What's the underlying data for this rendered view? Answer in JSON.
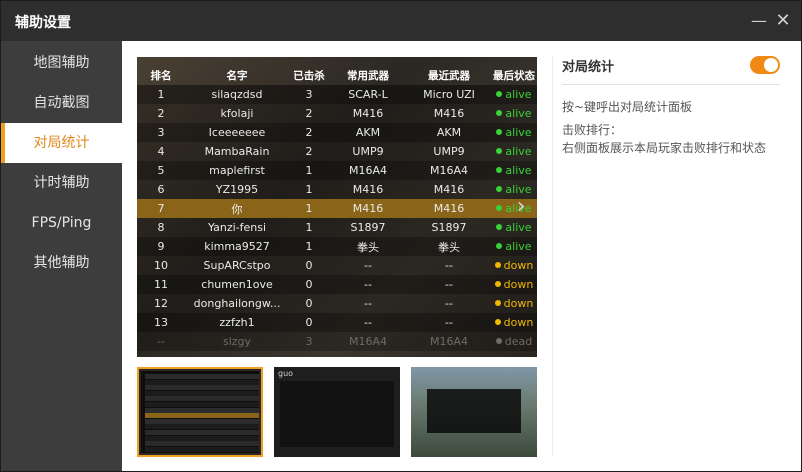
{
  "window": {
    "title": "辅助设置",
    "min_glyph": "—",
    "close_glyph": "✕"
  },
  "sidebar": {
    "items": [
      {
        "label": "地图辅助",
        "active": false
      },
      {
        "label": "自动截图",
        "active": false
      },
      {
        "label": "对局统计",
        "active": true
      },
      {
        "label": "计时辅助",
        "active": false
      },
      {
        "label": "FPS/Ping",
        "active": false
      },
      {
        "label": "其他辅助",
        "active": false
      }
    ]
  },
  "preview": {
    "headers": [
      "排名",
      "名字",
      "已击杀",
      "常用武器",
      "最近武器",
      "最后状态"
    ],
    "rows": [
      {
        "rank": "1",
        "name": "silaqzdsd",
        "kills": "3",
        "weapon_common": "SCAR-L",
        "weapon_recent": "Micro UZI",
        "status": "alive"
      },
      {
        "rank": "2",
        "name": "kfolaji",
        "kills": "2",
        "weapon_common": "M416",
        "weapon_recent": "M416",
        "status": "alive"
      },
      {
        "rank": "3",
        "name": "Iceeeeeee",
        "kills": "2",
        "weapon_common": "AKM",
        "weapon_recent": "AKM",
        "status": "alive"
      },
      {
        "rank": "4",
        "name": "MambaRain",
        "kills": "2",
        "weapon_common": "UMP9",
        "weapon_recent": "UMP9",
        "status": "alive"
      },
      {
        "rank": "5",
        "name": "maplefirst",
        "kills": "1",
        "weapon_common": "M16A4",
        "weapon_recent": "M16A4",
        "status": "alive"
      },
      {
        "rank": "6",
        "name": "YZ1995",
        "kills": "1",
        "weapon_common": "M416",
        "weapon_recent": "M416",
        "status": "alive"
      },
      {
        "rank": "7",
        "name": "你",
        "kills": "1",
        "weapon_common": "M416",
        "weapon_recent": "M416",
        "status": "alive",
        "me": true
      },
      {
        "rank": "8",
        "name": "Yanzi-fensi",
        "kills": "1",
        "weapon_common": "S1897",
        "weapon_recent": "S1897",
        "status": "alive"
      },
      {
        "rank": "9",
        "name": "kimma9527",
        "kills": "1",
        "weapon_common": "拳头",
        "weapon_recent": "拳头",
        "status": "alive"
      },
      {
        "rank": "10",
        "name": "SupARCstpo",
        "kills": "0",
        "weapon_common": "--",
        "weapon_recent": "--",
        "status": "down"
      },
      {
        "rank": "11",
        "name": "chumen1ove",
        "kills": "0",
        "weapon_common": "--",
        "weapon_recent": "--",
        "status": "down"
      },
      {
        "rank": "12",
        "name": "donghailongw...",
        "kills": "0",
        "weapon_common": "--",
        "weapon_recent": "--",
        "status": "down"
      },
      {
        "rank": "13",
        "name": "zzfzh1",
        "kills": "0",
        "weapon_common": "--",
        "weapon_recent": "--",
        "status": "down"
      },
      {
        "rank": "--",
        "name": "slzgy",
        "kills": "3",
        "weapon_common": "M16A4",
        "weapon_recent": "M16A4",
        "status": "dead",
        "faded": true
      }
    ],
    "next_glyph": "›",
    "colors": {
      "alive": "#3ad13a",
      "down": "#f0b800",
      "dead": "#8a8a8a",
      "highlight": "#8a6418"
    }
  },
  "thumbnails": [
    {
      "name": "thumbnail-1",
      "selected": true
    },
    {
      "name": "thumbnail-2",
      "selected": false,
      "label": "guo"
    },
    {
      "name": "thumbnail-3",
      "selected": false
    }
  ],
  "settings": {
    "title": "对局统计",
    "enabled": true,
    "accent": "#f08a14",
    "lines": [
      "按~键呼出对局统计面板",
      "击败排行：",
      "右侧面板展示本局玩家击败排行和状态"
    ]
  }
}
